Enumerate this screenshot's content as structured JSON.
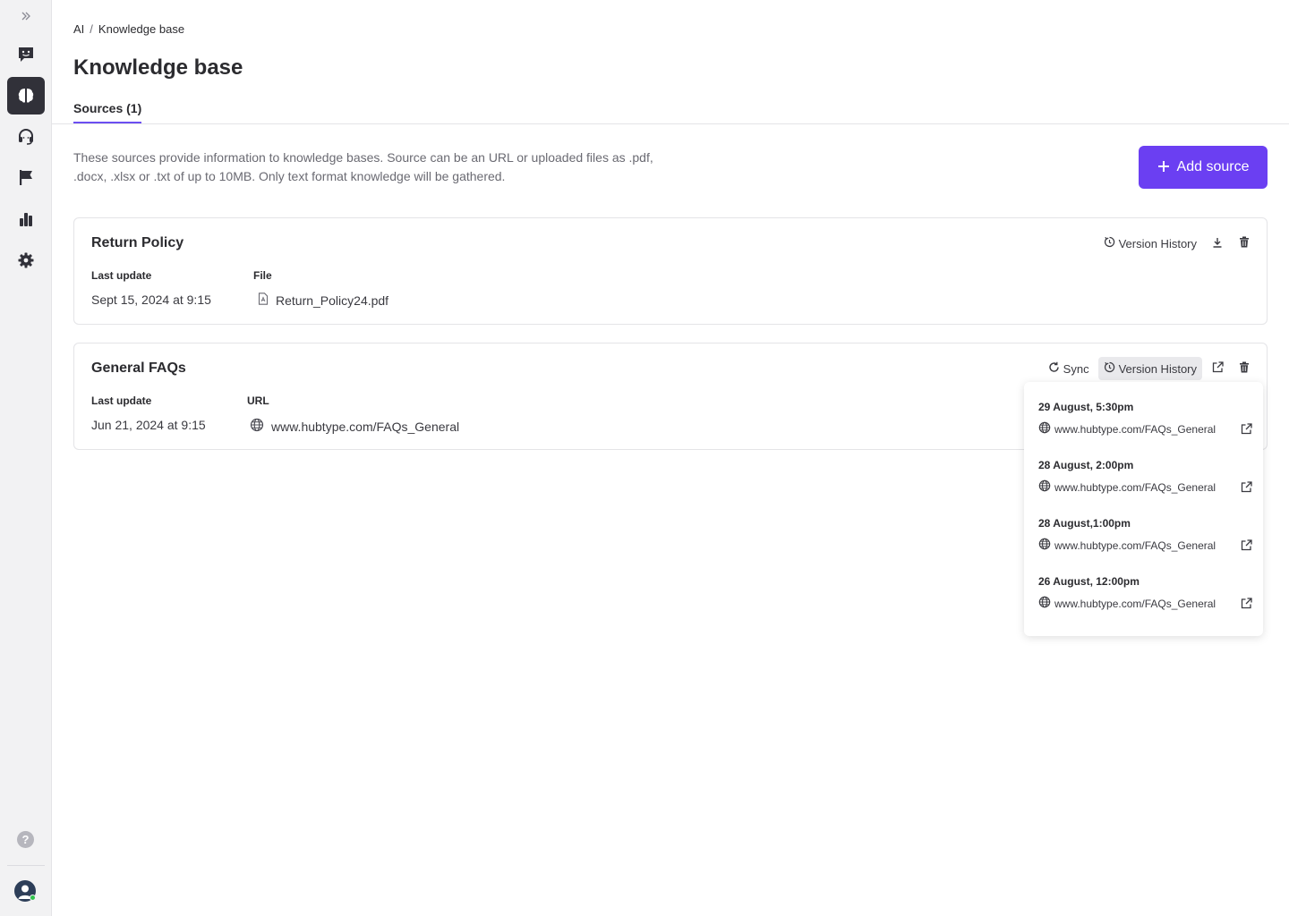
{
  "sidebar": {
    "expand_icon": "chevrons-right-icon",
    "items": [
      {
        "name": "conversations",
        "icon": "chat-bubble-smile-icon",
        "active": false
      },
      {
        "name": "ai",
        "icon": "brain-icon",
        "active": true
      },
      {
        "name": "support",
        "icon": "headset-icon",
        "active": false
      },
      {
        "name": "flows",
        "icon": "flag-icon",
        "active": false
      },
      {
        "name": "analytics",
        "icon": "bar-chart-icon",
        "active": false
      },
      {
        "name": "settings",
        "icon": "gear-icon",
        "active": false
      }
    ],
    "help_glyph": "?"
  },
  "breadcrumb": {
    "root": "AI",
    "separator": "/",
    "current": "Knowledge base"
  },
  "page": {
    "title": "Knowledge base",
    "tab_label": "Sources (1)",
    "description": "These sources provide information to knowledge bases. Source can be an URL or uploaded files as .pdf, .docx, .xlsx or .txt of up to 10MB. Only text format knowledge will be gathered.",
    "add_button_label": "Add source",
    "accent_color": "#6b3ff2"
  },
  "sources": [
    {
      "title": "Return Policy",
      "last_update_label": "Last update",
      "last_update_value": "Sept 15, 2024 at 9:15",
      "kind_label": "File",
      "kind_value": "Return_Policy24.pdf",
      "version_history_label": "Version History"
    },
    {
      "title": "General FAQs",
      "last_update_label": "Last update",
      "last_update_value": "Jun 21, 2024 at 9:15",
      "kind_label": "URL",
      "kind_value": "www.hubtype.com/FAQs_General",
      "sync_label": "Sync",
      "version_history_label": "Version History"
    }
  ],
  "version_history": [
    {
      "date": "29 August, 5:30pm",
      "url": "www.hubtype.com/FAQs_General"
    },
    {
      "date": "28 August, 2:00pm",
      "url": "www.hubtype.com/FAQs_General"
    },
    {
      "date": "28 August,1:00pm",
      "url": "www.hubtype.com/FAQs_General"
    },
    {
      "date": "26 August, 12:00pm",
      "url": "www.hubtype.com/FAQs_General"
    }
  ]
}
